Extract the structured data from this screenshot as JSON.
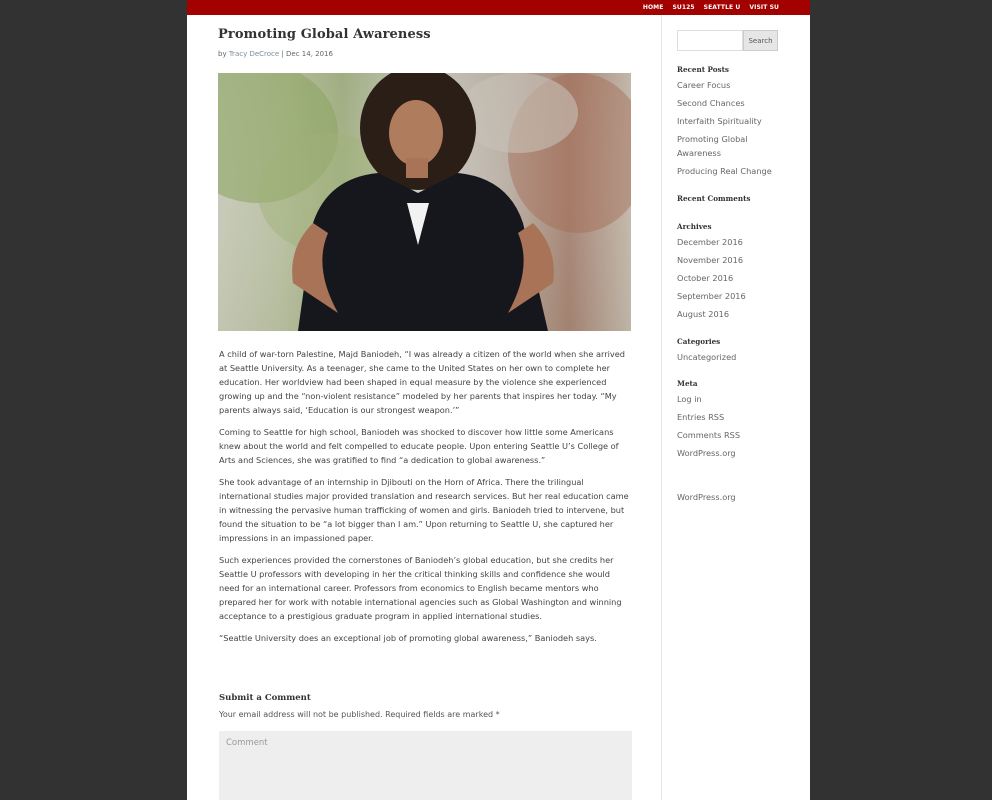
{
  "nav": [
    "HOME",
    "SU125",
    "SEATTLE U",
    "VISIT SU"
  ],
  "post": {
    "title": "Promoting Global Awareness",
    "meta_prefix": "by ",
    "author": "Tracy DeCroce",
    "meta_separator": " | ",
    "date": "Dec 14, 2016",
    "paragraphs": [
      "A child of war-torn Palestine, Majd Baniodeh, “I was already a citizen of the world when she arrived at Seattle University. As a teenager, she came to the United States on her own to complete her education. Her worldview had been shaped in equal measure by the violence she experienced growing up and the “non-violent resistance” modeled by her parents that inspires her today. “My parents always said, ‘Education is our strongest weapon.’”",
      "Coming to Seattle for high school, Baniodeh was shocked to discover how little some Americans knew about the world and felt compelled to educate people. Upon entering Seattle U’s College of Arts and Sciences, she was gratified to find “a dedication to global awareness.”",
      "She took advantage of an internship in Djibouti on the Horn of Africa. There the trilingual international studies major provided translation and research services. But her real education came in witnessing the pervasive human trafficking of women and girls. Baniodeh tried to intervene, but found the situation to be “a lot bigger than I am.” Upon returning to Seattle U, she captured her impressions in an impassioned paper.",
      "Such experiences provided the cornerstones of Baniodeh’s global education, but she credits her Seattle U professors with developing in her the critical thinking skills and confidence she would need for an international career. Professors from economics to English became mentors who prepared her for work with notable international agencies such as Global Washington and winning acceptance to a prestigious graduate program in applied international studies.",
      "“Seattle University does an exceptional job of promoting global awareness,” Baniodeh says."
    ]
  },
  "comment": {
    "heading": "Submit a Comment",
    "note": "Your email address will not be published. Required fields are marked *",
    "placeholder": "Comment"
  },
  "sidebar": {
    "search_button": "Search",
    "recent_posts_title": "Recent Posts",
    "recent_posts": [
      "Career Focus",
      "Second Chances",
      "Interfaith Spirituality",
      "Promoting Global Awareness",
      "Producing Real Change"
    ],
    "recent_comments_title": "Recent Comments",
    "archives_title": "Archives",
    "archives": [
      "December 2016",
      "November 2016",
      "October 2016",
      "September 2016",
      "August 2016"
    ],
    "categories_title": "Categories",
    "categories": [
      "Uncategorized"
    ],
    "meta_title": "Meta",
    "meta_links": [
      "Log in",
      "Entries RSS",
      "Comments RSS",
      "WordPress.org"
    ],
    "extra_link": "WordPress.org"
  },
  "colors": {
    "topbar": "#a30000",
    "background": "#323232"
  }
}
